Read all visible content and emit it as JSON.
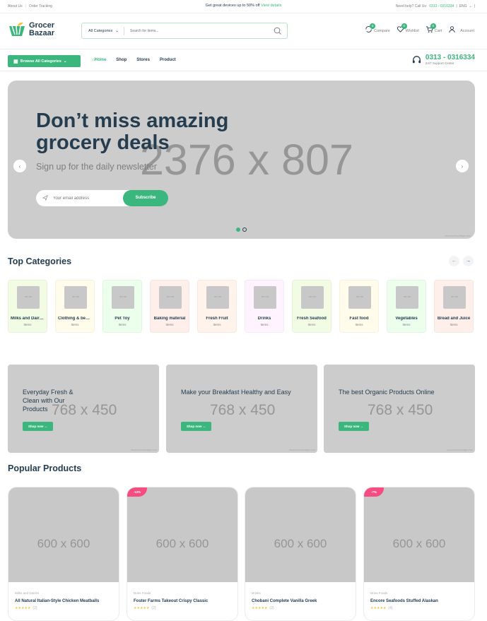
{
  "topbar": {
    "links": [
      "About Us",
      "Order Tracking"
    ],
    "promo_text": "Get great devices up to 50% off",
    "promo_link": "View details",
    "help_text": "Need help? Call Us:",
    "help_phone": "0313 - 0316334",
    "lang": "ENG"
  },
  "header": {
    "logo_line1": "Grocer",
    "logo_line2": "Bazaar",
    "search_category": "All Categories",
    "search_placeholder": "Search for items...",
    "compare_label": "Compare",
    "compare_count": "0",
    "wishlist_label": "Wishlist",
    "wishlist_count": "0",
    "cart_label": "Cart",
    "cart_count": "0",
    "account_label": "Account"
  },
  "nav": {
    "browse_label": "Browse All Categories",
    "menu": [
      "Home",
      "Shop",
      "Stores",
      "Product"
    ],
    "support_phone": "0313 - 0316334",
    "support_sub": "24/7 Support Center"
  },
  "hero": {
    "title": "Don’t miss amazing grocery deals",
    "subtitle": "Sign up for the daily newsletter",
    "email_placeholder": "Your email address",
    "subscribe_label": "Subscribe",
    "placeholder_size": "2376 x 807",
    "watermark": "www.dummyimage.com"
  },
  "top_categories": {
    "title": "Top Categories",
    "items": [
      {
        "name": "Milks and Dairies",
        "items": "Items",
        "bg": "#f2fce4"
      },
      {
        "name": "Clothing & beauty",
        "items": "Items",
        "bg": "#fffceb"
      },
      {
        "name": "Pet Toy",
        "items": "Items",
        "bg": "#ecffec"
      },
      {
        "name": "Baking material",
        "items": "Items",
        "bg": "#feefea"
      },
      {
        "name": "Fresh Fruit",
        "items": "Items",
        "bg": "#fff3eb"
      },
      {
        "name": "Drinks",
        "items": "Items",
        "bg": "#fff3ff"
      },
      {
        "name": "Fresh Seafood",
        "items": "Items",
        "bg": "#f2fce4"
      },
      {
        "name": "Fast food",
        "items": "Items",
        "bg": "#fffceb"
      },
      {
        "name": "Vegetables",
        "items": "Items",
        "bg": "#ecffec"
      },
      {
        "name": "Bread and Juice",
        "items": "Items",
        "bg": "#feefea"
      }
    ],
    "thumb_label": "60 x 60"
  },
  "banners": [
    {
      "title": "Everyday Fresh & Clean with Our Products",
      "button": "Shop now",
      "size": "768 x 450"
    },
    {
      "title": "Make your Breakfast Healthy and Easy",
      "button": "Shop now",
      "size": "768 x 450"
    },
    {
      "title": "The best Organic Products Online",
      "button": "Shop now",
      "size": "768 x 450"
    }
  ],
  "banner_watermark": "www.dummyimage.com",
  "popular": {
    "title": "Popular Products",
    "products": [
      {
        "category": "Milks and Dairies",
        "name": "All Natural Italian-Style Chicken Meatballs",
        "rating": "(2)",
        "tag": "",
        "size": "600 x 600"
      },
      {
        "category": "Dries Foods",
        "name": "Foster Farms Takeout Crispy Classic",
        "rating": "(2)",
        "tag": "-10%",
        "size": "600 x 600"
      },
      {
        "category": "Drinks",
        "name": "Chobani Complete Vanilla Greek",
        "rating": "(2)",
        "tag": "",
        "size": "600 x 600"
      },
      {
        "category": "Dries Foods",
        "name": "Encore Seafoods Stuffed Alaskan",
        "rating": "(4)",
        "tag": "-7%",
        "size": "600 x 600"
      }
    ]
  },
  "colors": {
    "accent": "#3bb77e",
    "heading": "#253d4e",
    "sale": "#f74b81"
  }
}
